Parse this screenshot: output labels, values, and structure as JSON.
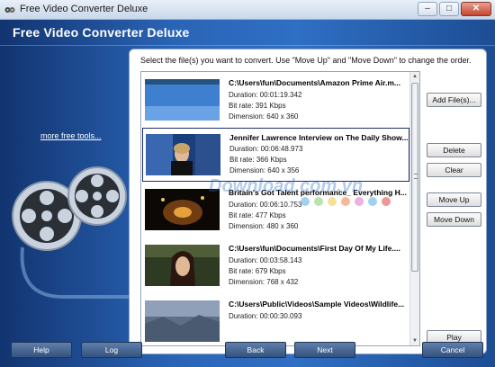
{
  "window": {
    "title": "Free Video Converter Deluxe"
  },
  "header": {
    "title": "Free Video Converter Deluxe"
  },
  "sidebar": {
    "more_tools_link": "more free tools..."
  },
  "main": {
    "instructions": "Select the file(s) you want to convert. Use \"Move Up\" and \"Move Down\" to change the order.",
    "files": [
      {
        "name": "C:\\Users\\fun\\Documents\\Amazon Prime Air.m...",
        "duration": "Duration: 00:01:19.342",
        "bitrate": "Bit rate: 391 Kbps",
        "dimension": "Dimension: 640 x 360",
        "thumb": "sky"
      },
      {
        "name": "Jennifer Lawrence Interview on The Daily Show...",
        "duration": "Duration: 00:06:48.973",
        "bitrate": "Bit rate: 366 Kbps",
        "dimension": "Dimension: 640 x 356",
        "thumb": "studio"
      },
      {
        "name": "Britain's Got Talent performance_ Everything H...",
        "duration": "Duration: 00:06:10.753",
        "bitrate": "Bit rate: 477 Kbps",
        "dimension": "Dimension: 480 x 360",
        "thumb": "stage"
      },
      {
        "name": "C:\\Users\\fun\\Documents\\First Day Of My Life....",
        "duration": "Duration: 00:03:58.143",
        "bitrate": "Bit rate: 679 Kbps",
        "dimension": "Dimension: 768 x 432",
        "thumb": "portrait"
      },
      {
        "name": "C:\\Users\\Public\\Videos\\Sample Videos\\Wildlife...",
        "duration": "Duration: 00:00:30.093",
        "bitrate": "",
        "dimension": "",
        "thumb": "wildlife"
      }
    ],
    "buttons": {
      "add_files": "Add File(s)...",
      "delete": "Delete",
      "clear": "Clear",
      "move_up": "Move Up",
      "move_down": "Move Down",
      "play": "Play"
    }
  },
  "footer": {
    "help": "Help",
    "log": "Log",
    "back": "Back",
    "next": "Next",
    "cancel": "Cancel"
  },
  "watermark": "Download.com.vn",
  "colors": {
    "accent": "#2f6fc4",
    "header_bg": "#1f4a8c",
    "selection_border": "#1c2f6b"
  }
}
